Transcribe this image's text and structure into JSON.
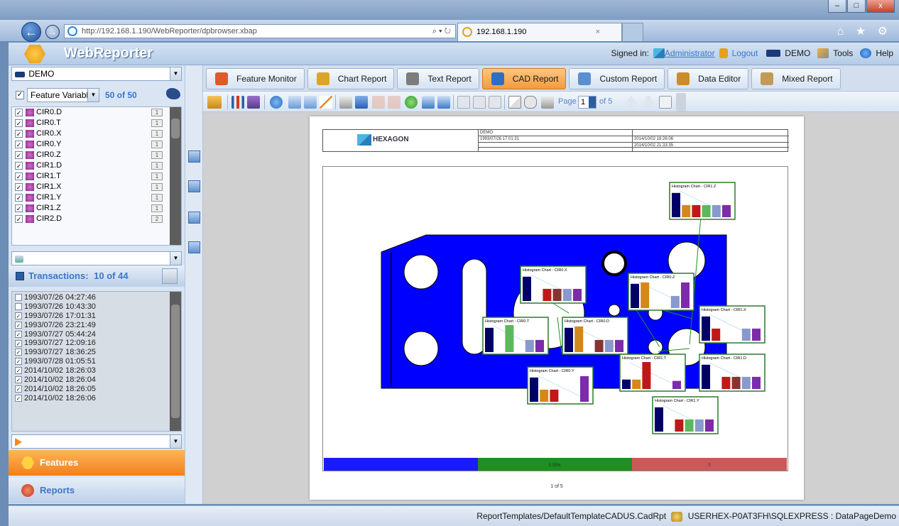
{
  "browser": {
    "url": "http://192.168.1.190/WebReporter/dpbrowser.xbap",
    "url_host": "192.168.1.190",
    "url_path": "/WebReporter/dpbrowser.xbap",
    "tab_title": "192.168.1.190",
    "search_glyph": "⌕ ▾ ↻",
    "tab_close": "×",
    "win_min": "–",
    "win_max": "□",
    "win_close": "x",
    "nav_icons": "⌂ ★ ⚙"
  },
  "header": {
    "app_title": "WebReporter",
    "signed_in_label": "Signed in:",
    "user": "Administrator",
    "logout": "Logout",
    "database": "DEMO",
    "tools": "Tools",
    "help": "Help"
  },
  "left": {
    "database_select": "DEMO",
    "feature_filter": "Feature Variable",
    "feature_count": "50 of 50",
    "features": [
      {
        "label": "CIR0.D",
        "badge": "1",
        "checked": true
      },
      {
        "label": "CIR0.T",
        "badge": "1",
        "checked": true
      },
      {
        "label": "CIR0.X",
        "badge": "1",
        "checked": true
      },
      {
        "label": "CIR0.Y",
        "badge": "1",
        "checked": true
      },
      {
        "label": "CIR0.Z",
        "badge": "1",
        "checked": true
      },
      {
        "label": "CIR1.D",
        "badge": "1",
        "checked": true
      },
      {
        "label": "CIR1.T",
        "badge": "1",
        "checked": true
      },
      {
        "label": "CIR1.X",
        "badge": "1",
        "checked": true
      },
      {
        "label": "CIR1.Y",
        "badge": "1",
        "checked": true
      },
      {
        "label": "CIR1.Z",
        "badge": "1",
        "checked": true
      },
      {
        "label": "CIR2.D",
        "badge": "2",
        "checked": true
      }
    ],
    "transactions_label": "Transactions:",
    "transactions_count": "10 of 44",
    "transactions": [
      {
        "label": "1993/07/26 04:27:46",
        "checked": false
      },
      {
        "label": "1993/07/26 10:43:30",
        "checked": false
      },
      {
        "label": "1993/07/26 17:01:31",
        "checked": true
      },
      {
        "label": "1993/07/26 23:21:49",
        "checked": true
      },
      {
        "label": "1993/07/27 05:44:24",
        "checked": true
      },
      {
        "label": "1993/07/27 12:09:16",
        "checked": true
      },
      {
        "label": "1993/07/27 18:36:25",
        "checked": true
      },
      {
        "label": "1993/07/28 01:05:51",
        "checked": true
      },
      {
        "label": "2014/10/02 18:26:03",
        "checked": true
      },
      {
        "label": "2014/10/02 18:26:04",
        "checked": true
      },
      {
        "label": "2014/10/02 18:26:05",
        "checked": true
      },
      {
        "label": "2014/10/02 18:26:06",
        "checked": true
      }
    ],
    "features_button": "Features",
    "reports_button": "Reports"
  },
  "tabs": [
    {
      "label": "Feature Monitor",
      "icon": "pie-chart-icon",
      "color": "#e0592a",
      "active": false
    },
    {
      "label": "Chart Report",
      "icon": "bar-chart-icon",
      "color": "#d9a629",
      "active": false
    },
    {
      "label": "Text Report",
      "icon": "text-document-icon",
      "color": "#7c7c7c",
      "active": false
    },
    {
      "label": "CAD Report",
      "icon": "cad-icon",
      "color": "#2f6fc2",
      "active": true
    },
    {
      "label": "Custom Report",
      "icon": "custom-report-icon",
      "color": "#5b8fd1",
      "active": false
    },
    {
      "label": "Data Editor",
      "icon": "data-editor-icon",
      "color": "#c98d2a",
      "active": false
    },
    {
      "label": "Mixed Report",
      "icon": "mixed-report-icon",
      "color": "#c29a5a",
      "active": false
    }
  ],
  "toolbar": {
    "page_label": "Page",
    "page_value": "1",
    "page_of": "of 5"
  },
  "report": {
    "logo_text": "HEXAGON",
    "header_db": "DEMO",
    "header_date1": "1993/07/26 17:01:31",
    "header_date2": "2014/10/02 18:26:06",
    "header_date3": "2014/10/02 21:33:35",
    "pager_text": "1    of  5",
    "bars": [
      {
        "color": "#1a1aff",
        "label": ""
      },
      {
        "color": "#1f8f1f",
        "label": "1  00%"
      },
      {
        "color": "#c85a5a",
        "label": "0"
      }
    ],
    "histograms": [
      {
        "title": "Histogram Chart - CIR1.Z"
      },
      {
        "title": "Histogram Chart - CIR0.X"
      },
      {
        "title": "Histogram Chart - CIR0.Z"
      },
      {
        "title": "Histogram Chart - CIR1.X"
      },
      {
        "title": "Histogram Chart - CIR0.T"
      },
      {
        "title": "Histogram Chart - CIR0.D"
      },
      {
        "title": "Histogram Chart - CIR1.T"
      },
      {
        "title": "Histogram Chart - CIR1.D"
      },
      {
        "title": "Histogram Chart - CIR0.Y"
      },
      {
        "title": "Histogram Chart - CIR1.Y"
      }
    ]
  },
  "status": {
    "template_path": "ReportTemplates/DefaultTemplateCADUS.CadRpt",
    "connection": "USERHEX-P0AT3FH\\SQLEXPRESS : DataPageDemo"
  }
}
